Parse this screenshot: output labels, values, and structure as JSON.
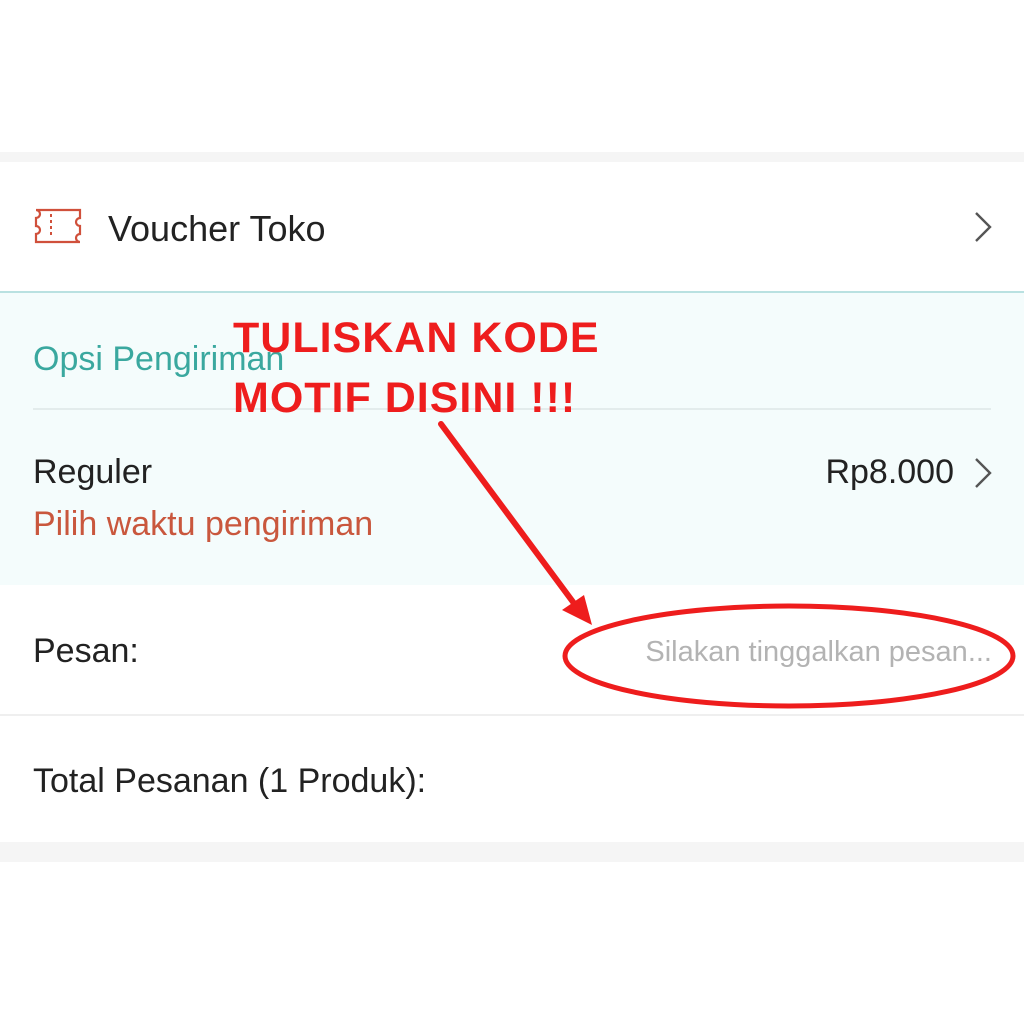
{
  "voucher": {
    "label": "Voucher Toko",
    "icon": "ticket-icon",
    "accent": "#d0503b"
  },
  "shipping": {
    "title": "Opsi Pengiriman",
    "method": "Reguler",
    "price": "Rp8.000",
    "time_prompt": "Pilih waktu pengiriman"
  },
  "message": {
    "label": "Pesan:",
    "placeholder": "Silakan tinggalkan pesan...",
    "value": ""
  },
  "total": {
    "label": "Total Pesanan (1 Produk):"
  },
  "annotation": {
    "line1": "TULISKAN KODE",
    "line2": "MOTIF DISINI !!!",
    "color": "#ee1d1d"
  },
  "colors": {
    "teal": "#3aa89f",
    "orange": "#c9573d",
    "box_bg": "#f4fcfc"
  }
}
